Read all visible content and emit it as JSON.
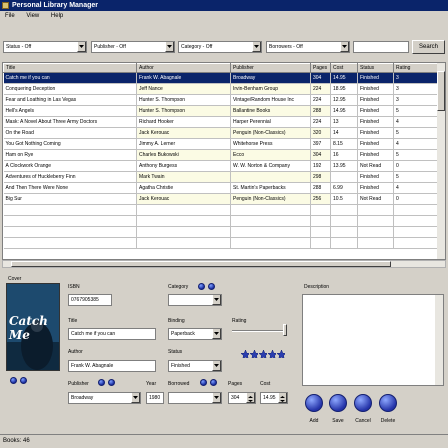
{
  "window": {
    "title": "Personal Library Manager"
  },
  "menu": [
    "File",
    "View",
    "Help"
  ],
  "filters": {
    "status": "Status - Off",
    "publisher": "Publisher - Off",
    "category": "Category - Off",
    "borrowers": "Borrowers - Off",
    "search_value": "",
    "search_label": "Search"
  },
  "table": {
    "columns": [
      "Title",
      "Author",
      "Publisher",
      "Pages",
      "Cost",
      "Status",
      "Rating"
    ],
    "rows": [
      [
        "Catch me if you can",
        "Frank W. Abagnale",
        "Broadway",
        "304",
        "14.95",
        "Finished",
        "3"
      ],
      [
        "Conquering Deception",
        "Jeff Nance",
        "Irvin-Benham Group",
        "224",
        "18.95",
        "Finished",
        "3"
      ],
      [
        "Fear and Loathing in Las Vegas",
        "Hunter S. Thompson",
        "Vintage/Random House Inc",
        "224",
        "12.95",
        "Finished",
        "3"
      ],
      [
        "Hell's Angels",
        "Hunter S. Thompson",
        "Ballantine Books",
        "288",
        "14.95",
        "Finished",
        "5"
      ],
      [
        "Mask: A Novel About Three Army Doctors",
        "Richard Hooker",
        "Harper Perennial",
        "224",
        "13",
        "Finished",
        "4"
      ],
      [
        "On the Road",
        "Jack Kerouac",
        "Penguin (Non-Classics)",
        "320",
        "14",
        "Finished",
        "5"
      ],
      [
        "You Got Nothing Coming",
        "Jimmy A. Lerner",
        "Whitehorse Press",
        "397",
        "8.15",
        "Finished",
        "4"
      ],
      [
        "Ham on Rye",
        "Charles Bukowski",
        "Ecco",
        "304",
        "16",
        "Finished",
        "5"
      ],
      [
        "A Clockwork Orange",
        "Anthony Burgess",
        "W. W. Norton & Company",
        "192",
        "13.95",
        "Not Read",
        "0"
      ],
      [
        "Adventures of Huckleberry Finn",
        "Mark Twain",
        "",
        "298",
        "",
        "Finished",
        "5"
      ],
      [
        "And Then There Were None",
        "Agatha Christie",
        "St. Martin's Paperbacks",
        "288",
        "6.99",
        "Finished",
        "4"
      ],
      [
        "Big Sur",
        "Jack Kerouac",
        "Penguin (Non-Classics)",
        "256",
        "10.5",
        "Not Read",
        "0"
      ]
    ]
  },
  "details": {
    "cover_label": "Cover",
    "cover_text": "Catch Me",
    "isbn_label": "ISBN",
    "isbn_value": "0767905385",
    "title_label": "Title",
    "title_value": "Catch me if you can",
    "author_label": "Author",
    "author_value": "Frank W. Abagnale",
    "publisher_label": "Publisher",
    "publisher_value": "Broadway",
    "year_label": "Year",
    "year_value": "1980",
    "category_label": "Category",
    "category_value": "",
    "binding_label": "Binding",
    "binding_value": "Paperback",
    "status_label": "Status",
    "status_value": "Finished",
    "borrowed_label": "Borrowed",
    "borrowed_value": "",
    "pages_label": "Pages",
    "pages_value": "304",
    "cost_label": "Cost",
    "cost_value": "14.95",
    "rating_label": "Rating",
    "rating_value": 5,
    "description_label": "Description"
  },
  "actions": [
    "Add",
    "Save",
    "Cancel",
    "Delete"
  ],
  "statusbar": {
    "text": "Books: 46"
  },
  "colors": {
    "title_bar": "#0a246a",
    "selection": "#0a246a",
    "alt_row": "#fbfbe4",
    "button_blue": "#2433a8"
  }
}
